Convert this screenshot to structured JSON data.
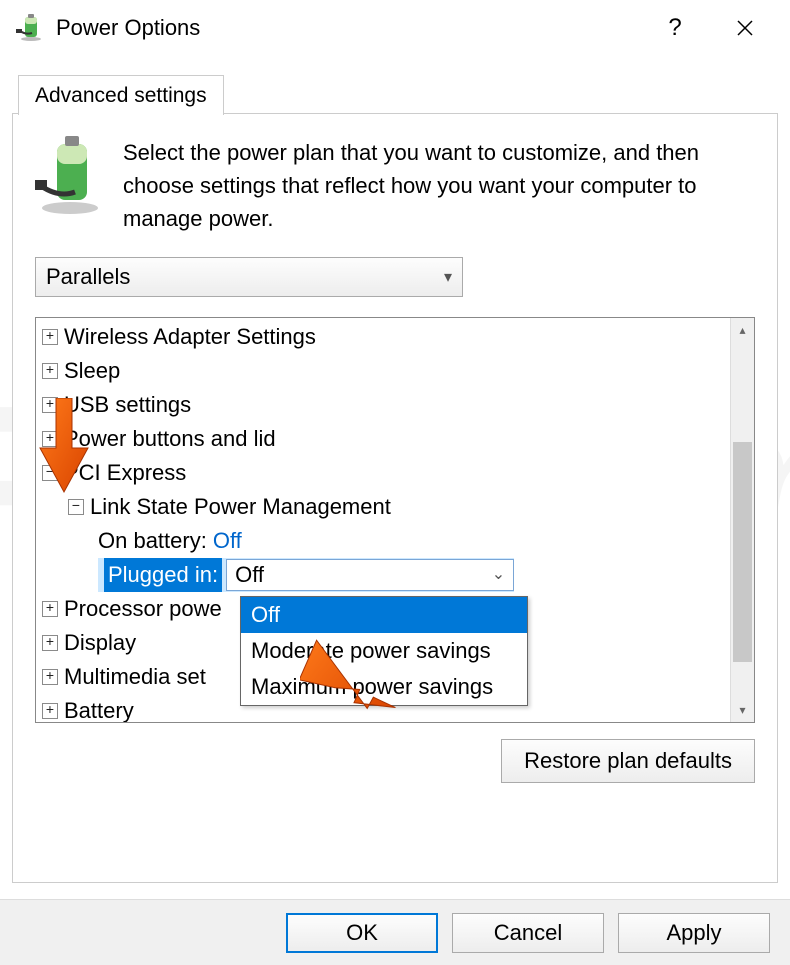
{
  "title": "Power Options",
  "tab": {
    "label": "Advanced settings"
  },
  "intro": "Select the power plan that you want to customize, and then choose settings that reflect how you want your computer to manage power.",
  "plan": "Parallels",
  "tree": {
    "wireless": "Wireless Adapter Settings",
    "sleep": "Sleep",
    "usb": "USB settings",
    "powerbtn": "Power buttons and lid",
    "pci": "PCI Express",
    "lspm": "Link State Power Management",
    "onbattery_label": "On battery:",
    "onbattery_value": "Off",
    "pluggedin_label": "Plugged in:",
    "pluggedin_value": "Off",
    "proc": "Processor powe",
    "display": "Display",
    "mm": "Multimedia set",
    "battery": "Battery"
  },
  "dropdown": {
    "opt1": "Off",
    "opt2": "Moderate power savings",
    "opt3": "Maximum power savings"
  },
  "restore": "Restore plan defaults",
  "buttons": {
    "ok": "OK",
    "cancel": "Cancel",
    "apply": "Apply"
  },
  "watermark": "PC....com"
}
